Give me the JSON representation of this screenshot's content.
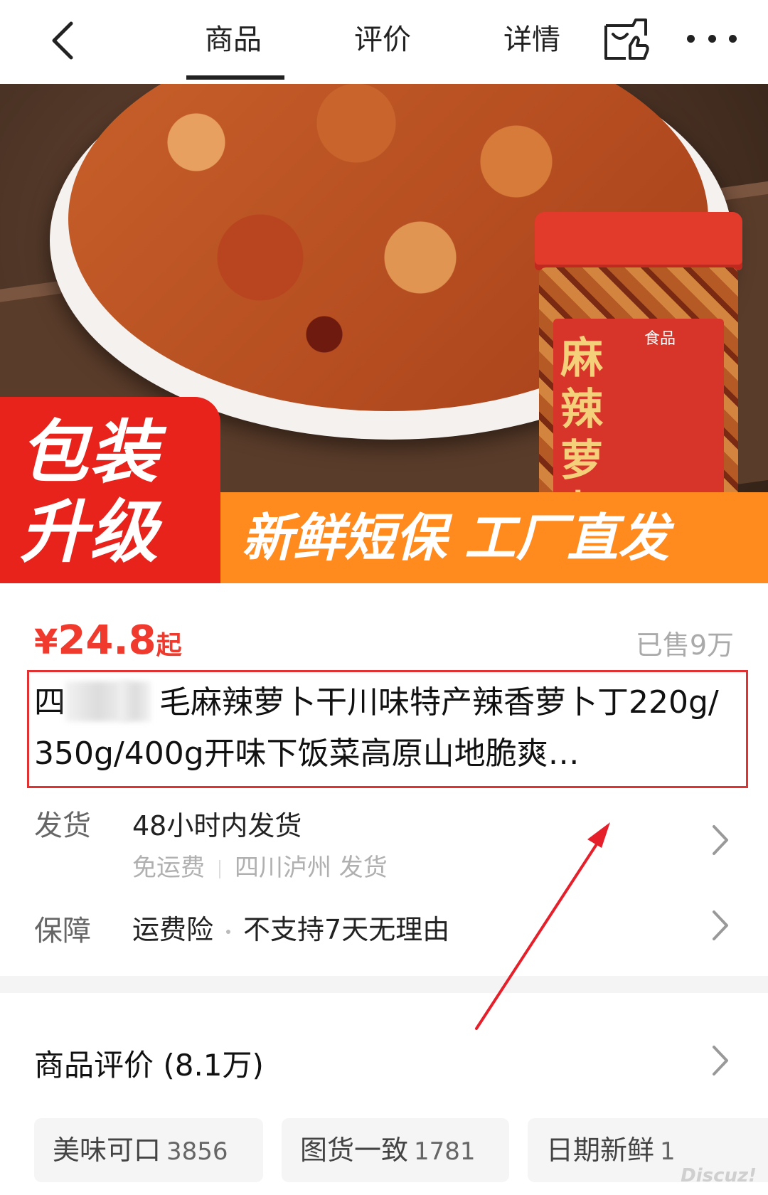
{
  "nav": {
    "tabs": [
      {
        "label": "商品"
      },
      {
        "label": "评价"
      },
      {
        "label": "详情"
      }
    ],
    "active_tab": "商品",
    "icons": [
      "back-icon",
      "share-bag-icon",
      "more-icon"
    ]
  },
  "hero": {
    "jar_label": "麻辣萝卜",
    "jar_brand": "食品",
    "promo_tag": "包装升级",
    "promo_banner": "新鲜短保 工厂直发"
  },
  "product": {
    "price_symbol": "¥",
    "price_value": "24.8",
    "price_suffix": "起",
    "sold": "已售9万",
    "title": "四　　　毛麻辣萝卜干川味特产辣香萝卜丁220g/350g/400g开味下饭菜高原山地脆爽…"
  },
  "shipping": {
    "label": "发货",
    "value": "48小时内发货",
    "free_shipping": "免运费",
    "origin": "四川泸州 发货"
  },
  "guarantee": {
    "label": "保障",
    "item1": "运费险",
    "item2": "不支持7天无理由"
  },
  "reviews": {
    "title": "商品评价 (8.1万)",
    "tags": [
      {
        "label": "美味可口",
        "count": "3856"
      },
      {
        "label": "图货一致",
        "count": "1781"
      },
      {
        "label": "日期新鲜",
        "count": "1"
      }
    ]
  },
  "watermark": "Discuz!",
  "colors": {
    "price_red": "#ef3a2d",
    "highlight_box": "#e33030",
    "promo_red": "#e8231c",
    "promo_orange": "#ff8a1e",
    "annotation_arrow": "#e6202a"
  }
}
